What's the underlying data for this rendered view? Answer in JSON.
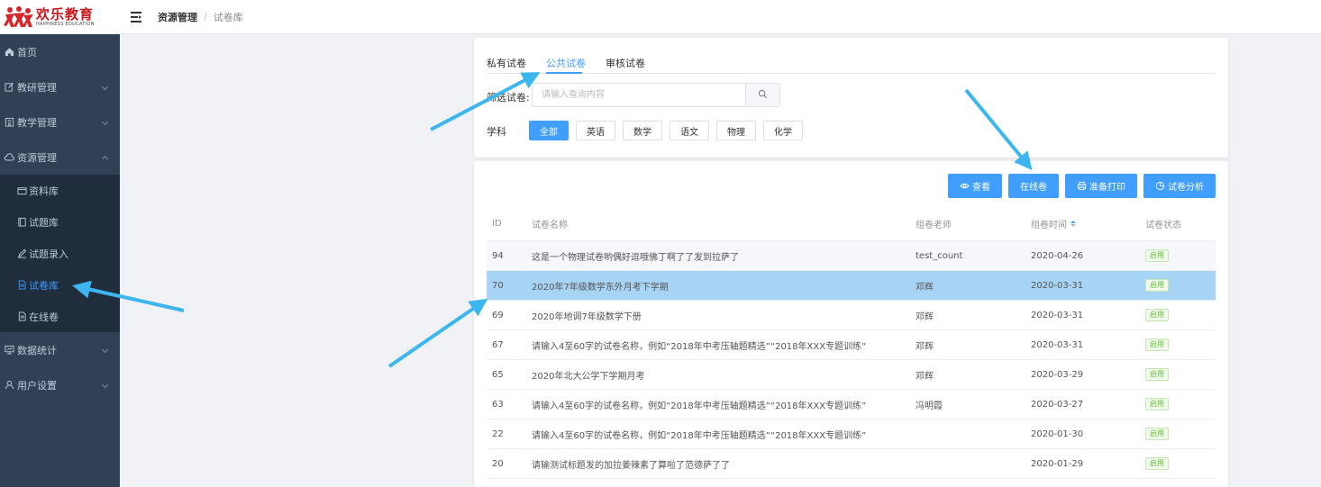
{
  "header": {
    "logo_title": "欢乐教育",
    "logo_subtitle": "HAPPINESS EDUCATION",
    "breadcrumb_main": "资源管理",
    "breadcrumb_sep": "/",
    "breadcrumb_current": "试卷库"
  },
  "sidebar": {
    "items": [
      {
        "label": "首页"
      },
      {
        "label": "教研管理"
      },
      {
        "label": "教学管理"
      },
      {
        "label": "资源管理"
      },
      {
        "label": "数据统计"
      },
      {
        "label": "用户设置"
      }
    ],
    "submenu": [
      {
        "label": "资料库"
      },
      {
        "label": "试题库"
      },
      {
        "label": "试题录入"
      },
      {
        "label": "试卷库"
      },
      {
        "label": "在线卷"
      }
    ]
  },
  "tabs": [
    {
      "label": "私有试卷"
    },
    {
      "label": "公共试卷"
    },
    {
      "label": "审核试卷"
    }
  ],
  "filter": {
    "label": "筛选试卷:",
    "placeholder": "请输入查询内容",
    "value": ""
  },
  "subjects": {
    "label": "学科",
    "items": [
      "全部",
      "英语",
      "数学",
      "语文",
      "物理",
      "化学"
    ],
    "selected": "全部"
  },
  "toolbar": {
    "view": "查看",
    "online": "在线卷",
    "print": "准备打印",
    "analysis": "试卷分析"
  },
  "table": {
    "headers": {
      "id": "ID",
      "name": "试卷名称",
      "teacher": "组卷老师",
      "time": "组卷时间",
      "status": "试卷状态"
    },
    "rows": [
      {
        "id": "94",
        "name": "这是一个物理试卷哟偶好逗哦佛丁啊了了发到拉萨了",
        "teacher": "test_count",
        "time": "2020-04-26",
        "status": "启用"
      },
      {
        "id": "70",
        "name": "2020年7年级数学东外月考下学期",
        "teacher": "邓辉",
        "time": "2020-03-31",
        "status": "启用"
      },
      {
        "id": "69",
        "name": "2020年地调7年级数学下册",
        "teacher": "邓辉",
        "time": "2020-03-31",
        "status": "启用"
      },
      {
        "id": "67",
        "name": "请输入4至60字的试卷名称，例如“2018年中考压轴题精选”“2018年XXX专题训练”",
        "teacher": "邓辉",
        "time": "2020-03-31",
        "status": "启用"
      },
      {
        "id": "65",
        "name": "2020年北大公学下学期月考",
        "teacher": "邓辉",
        "time": "2020-03-29",
        "status": "启用"
      },
      {
        "id": "63",
        "name": "请输入4至60字的试卷名称，例如“2018年中考压轴题精选”“2018年XXX专题训练”",
        "teacher": "冯明霞",
        "time": "2020-03-27",
        "status": "启用"
      },
      {
        "id": "22",
        "name": "请输入4至60字的试卷名称，例如“2018年中考压轴题精选”“2018年XXX专题训练”",
        "teacher": "",
        "time": "2020-01-30",
        "status": "启用"
      },
      {
        "id": "20",
        "name": "请输测试标题发的加拉姜辣素了算啦了范德萨了了",
        "teacher": "",
        "time": "2020-01-29",
        "status": "启用"
      }
    ]
  },
  "colors": {
    "sidebar_bg": "#304156",
    "submenu_bg": "#1f2d3d",
    "primary": "#409eff",
    "selected_row": "#a7d3f4",
    "success": "#67c23a",
    "arrow": "#3db6f0"
  }
}
